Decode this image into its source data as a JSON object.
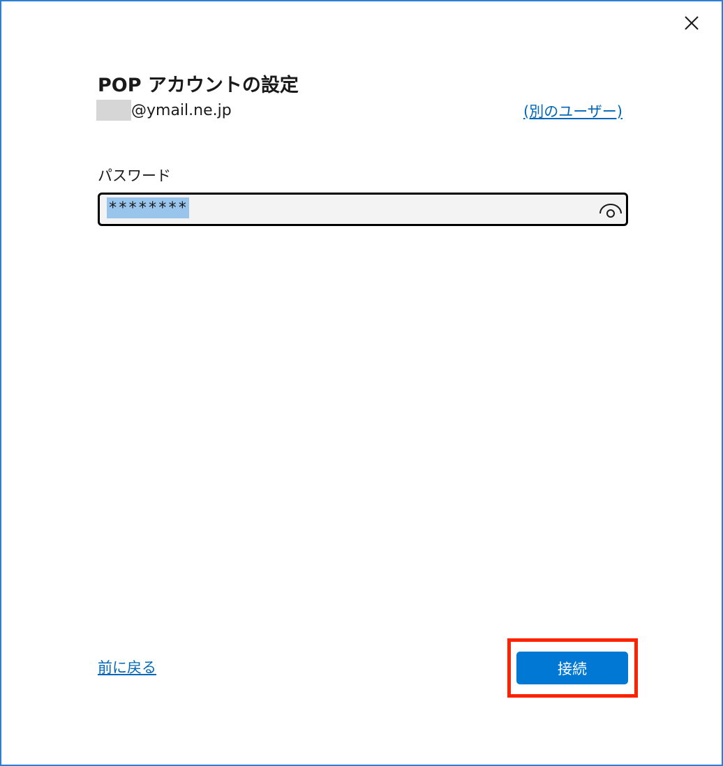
{
  "dialog": {
    "title": "POP アカウントの設定",
    "email_domain": "@ymail.ne.jp",
    "other_user_link": "(別のユーザー)",
    "password_label": "パスワード",
    "password_value": "********",
    "back_link": "前に戻る",
    "connect_button": "接続"
  },
  "icons": {
    "close": "close-icon",
    "reveal_password": "eye-icon"
  },
  "colors": {
    "accent": "#0078d4",
    "link": "#0067b8",
    "window_border": "#2b7fd4",
    "highlight_annotation": "#ff2200",
    "selection": "#99c4ec"
  }
}
